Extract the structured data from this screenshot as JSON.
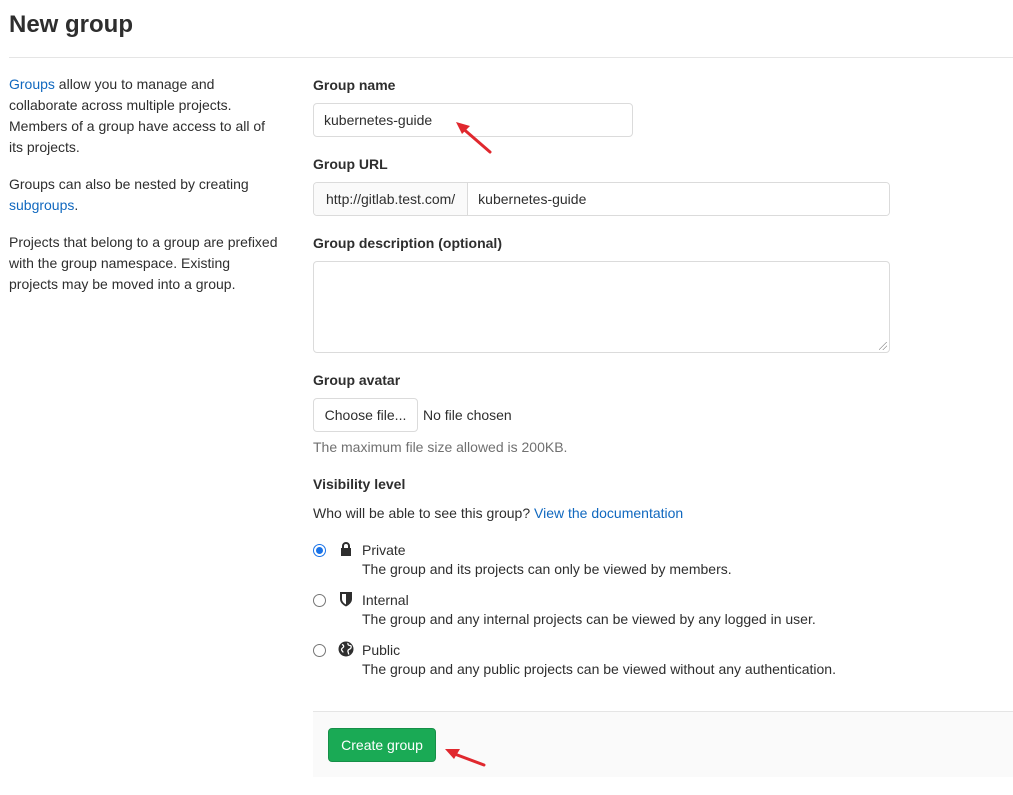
{
  "page": {
    "title": "New group"
  },
  "sidebar": {
    "p1_link": "Groups",
    "p1_text": " allow you to manage and collaborate across multiple projects. Members of a group have access to all of its projects.",
    "p2_text": "Groups can also be nested by creating ",
    "p2_link": "subgroups",
    "p2_end": ".",
    "p3_text": "Projects that belong to a group are prefixed with the group namespace. Existing projects may be moved into a group."
  },
  "form": {
    "group_name_label": "Group name",
    "group_name_value": "kubernetes-guide",
    "group_url_label": "Group URL",
    "group_url_prefix": "http://gitlab.test.com/",
    "group_url_path": "kubernetes-guide",
    "description_label": "Group description (optional)",
    "description_value": "",
    "avatar_label": "Group avatar",
    "choose_file_label": "Choose file...",
    "file_status": "No file chosen",
    "avatar_help": "The maximum file size allowed is 200KB.",
    "visibility_label": "Visibility level",
    "visibility_question": "Who will be able to see this group? ",
    "visibility_doc_link": "View the documentation",
    "visibility_options": [
      {
        "name": "Private",
        "description": "The group and its projects can only be viewed by members.",
        "icon": "lock-icon",
        "checked": true
      },
      {
        "name": "Internal",
        "description": "The group and any internal projects can be viewed by any logged in user.",
        "icon": "shield-icon",
        "checked": false
      },
      {
        "name": "Public",
        "description": "The group and any public projects can be viewed without any authentication.",
        "icon": "globe-icon",
        "checked": false
      }
    ],
    "submit_label": "Create group"
  },
  "colors": {
    "link": "#1068bf",
    "primary_button": "#1aaa55",
    "annotation_arrow": "#e0282e"
  }
}
